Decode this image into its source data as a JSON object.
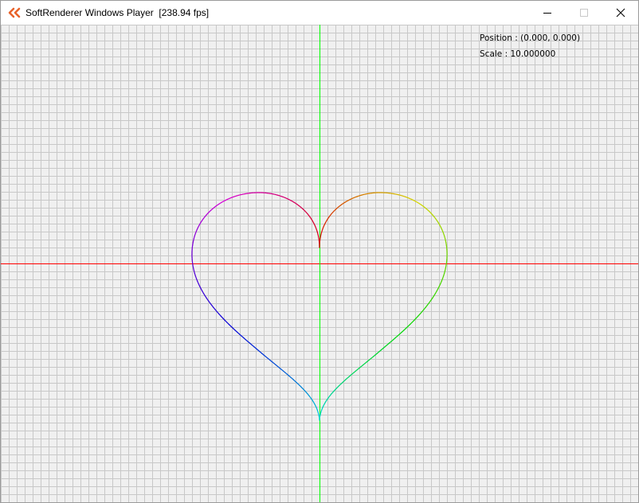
{
  "window": {
    "title": "SoftRenderer Windows Player  [238.94 fps]",
    "app_icon": "ck-logo-icon",
    "controls": {
      "minimize": "minimize-icon",
      "maximize": "maximize-icon",
      "close": "close-icon"
    }
  },
  "viewport": {
    "position_label": "Position : (0.000, 0.000)",
    "scale_label": "Scale : 10.000000",
    "grid": true,
    "colors": {
      "background": "#f0f0f0",
      "grid_line": "#c8c8c8",
      "x_axis": "#ff0000",
      "y_axis": "#00ff00"
    },
    "curve": {
      "shape": "heart",
      "coloring": "rainbow-gradient"
    }
  }
}
